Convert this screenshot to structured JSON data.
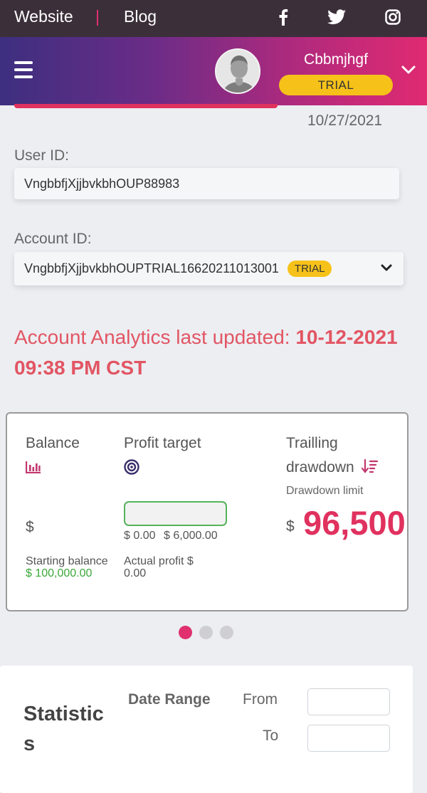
{
  "topbar": {
    "website": "Website",
    "blog": "Blog",
    "icons": [
      "facebook-icon",
      "twitter-icon",
      "instagram-icon"
    ]
  },
  "header": {
    "username": "Cbbmjhgf",
    "badge": "TRIAL"
  },
  "profile": {
    "date": "10/27/2021",
    "user_id_label": "User ID:",
    "user_id_value": "VngbbfjXjjbvkbhOUP88983",
    "account_id_label": "Account ID:",
    "account_id_value": "VngbbfjXjjbvkbhOUPTRIAL16620211013001",
    "account_badge": "TRIAL"
  },
  "analytics": {
    "prefix": "Account Analytics last updated:",
    "timestamp": "10-12-2021 09:38 PM CST"
  },
  "card": {
    "balance_label": "Balance",
    "balance_currency": "$",
    "starting_balance_label": "Starting balance",
    "starting_balance_value": "$ 100,000.00",
    "profit_target_label": "Profit target",
    "profit_min": "$ 0.00",
    "profit_target_value": "$ 6,000.00",
    "actual_profit_label": "Actual profit $",
    "actual_profit_value": "0.00",
    "drawdown_title_1": "Trailling",
    "drawdown_title_2": "drawdown",
    "drawdown_limit_label": "Drawdown limit",
    "drawdown_currency": "$",
    "drawdown_value": "96,500."
  },
  "carousel": {
    "count": 3,
    "active": 0
  },
  "stats": {
    "title": "Statistics",
    "date_range_label": "Date Range",
    "from_label": "From",
    "to_label": "To",
    "from_value": "",
    "to_value": ""
  },
  "colors": {
    "accent_pink": "#e0315f",
    "trial_yellow": "#f6c21a",
    "green": "#3aa83a",
    "topbar_bg": "#3b2f3a"
  }
}
